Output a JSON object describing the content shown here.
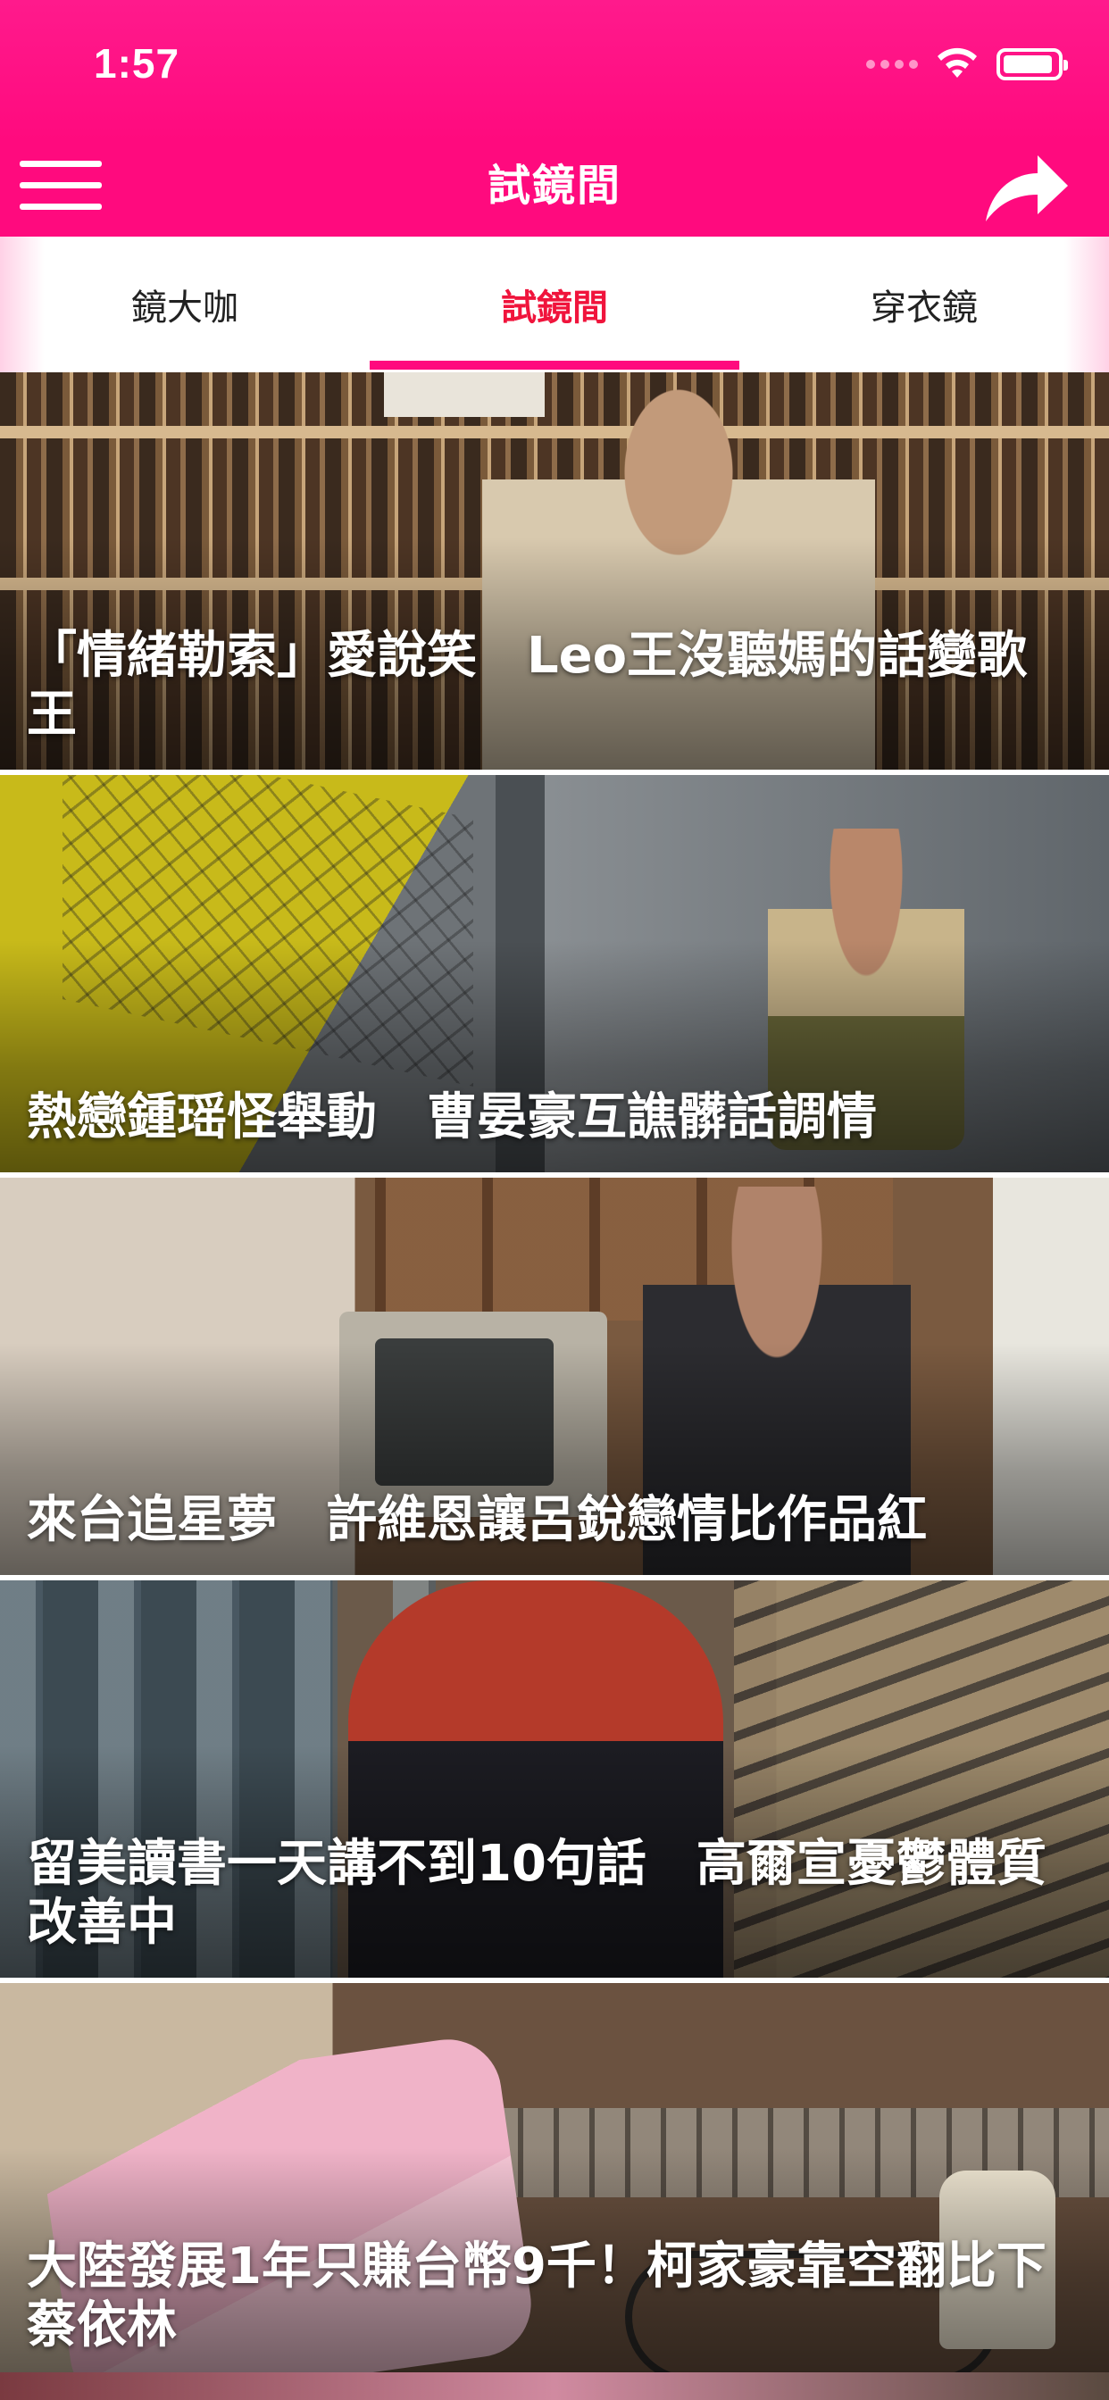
{
  "status_bar": {
    "time": "1:57"
  },
  "nav": {
    "title": "試鏡間"
  },
  "tabs": [
    {
      "label": "鏡大咖"
    },
    {
      "label": "試鏡間",
      "active": true
    },
    {
      "label": "穿衣鏡"
    }
  ],
  "articles": [
    {
      "headline": "「情緒勒索」愛說笑　Leo王沒聽媽的話變歌王"
    },
    {
      "headline": "熱戀鍾瑶怪舉動　曹晏豪互譙髒話調情"
    },
    {
      "headline": "來台追星夢　許維恩讓呂銳戀情比作品紅"
    },
    {
      "headline": "留美讀書一天講不到10句話　高爾宣憂鬱體質改善中"
    },
    {
      "headline": "大陸發展1年只賺台幣9千！柯家豪靠空翻比下蔡依林"
    }
  ],
  "colors": {
    "accent": "#ff0a7e",
    "active_tab": "#f0143c"
  },
  "icons": [
    "menu-icon",
    "share-icon",
    "wifi-icon",
    "battery-icon",
    "signal-icon"
  ]
}
